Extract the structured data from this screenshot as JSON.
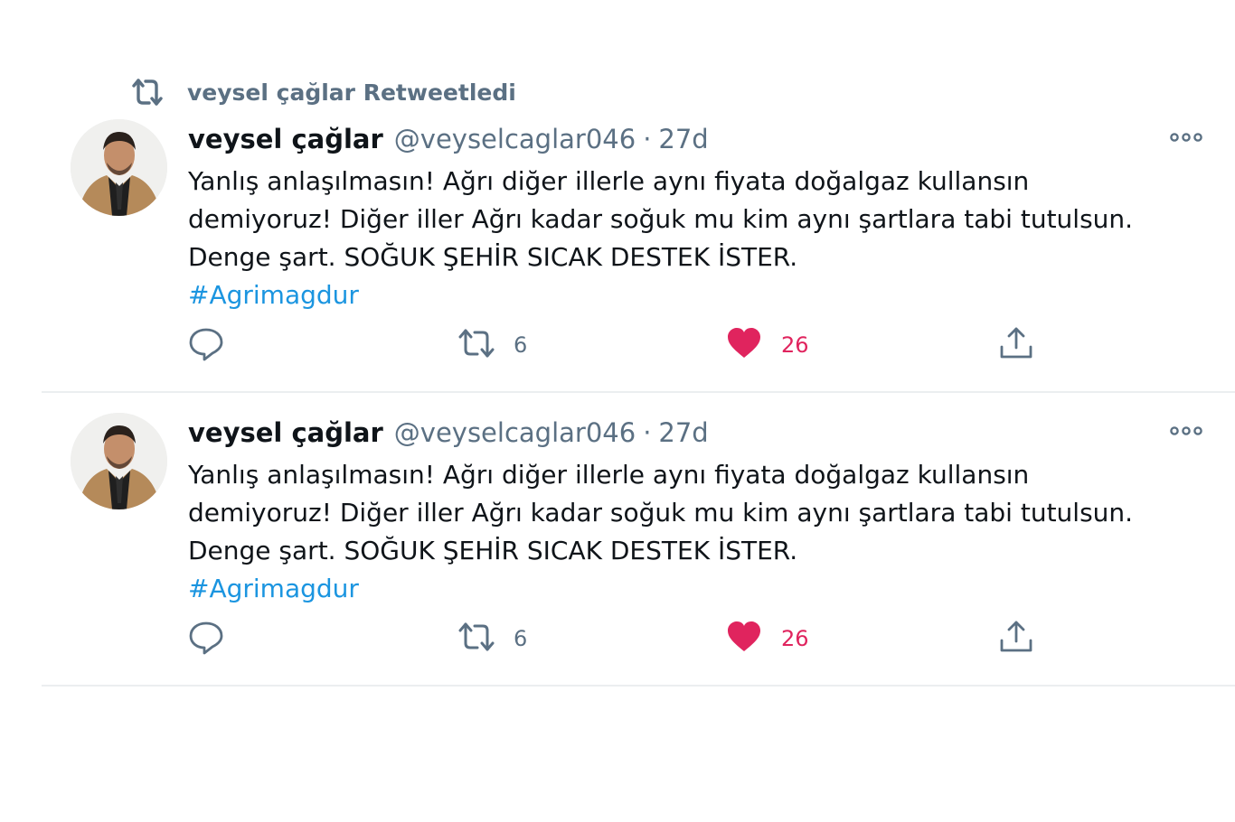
{
  "retweet_context": {
    "text": "veysel çağlar Retweetledi",
    "icon": "retweet-icon"
  },
  "tweets": [
    {
      "name": "veysel çağlar",
      "handle": "@veyselcaglar046",
      "separator": "·",
      "time": "27d",
      "lines": [
        "Yanlış anlaşılmasın! Ağrı diğer illerle aynı fiyata doğalgaz kullansın",
        "demiyoruz! Diğer iller Ağrı kadar soğuk mu kim aynı şartlara tabi tutulsun.",
        "Denge şart. SOĞUK ŞEHİR SICAK DESTEK İSTER."
      ],
      "hashtag": "#Agrimagdur",
      "retweets": "6",
      "likes": "26"
    },
    {
      "name": "veysel çağlar",
      "handle": "@veyselcaglar046",
      "separator": "·",
      "time": "27d",
      "lines": [
        "Yanlış anlaşılmasın! Ağrı diğer illerle aynı fiyata doğalgaz kullansın",
        "demiyoruz! Diğer iller Ağrı kadar soğuk mu kim aynı şartlara tabi tutulsun.",
        "Denge şart. SOĞUK ŞEHİR SICAK DESTEK İSTER."
      ],
      "hashtag": "#Agrimagdur",
      "retweets": "6",
      "likes": "26"
    }
  ],
  "colors": {
    "secondary_text": "#5b7083",
    "hashtag": "#1b95e0",
    "like": "#e0245e",
    "divider": "#ebeef0"
  },
  "icons": {
    "reply": "reply-icon",
    "retweet": "retweet-icon",
    "like": "heart-icon",
    "share": "share-icon",
    "more": "more-icon"
  }
}
